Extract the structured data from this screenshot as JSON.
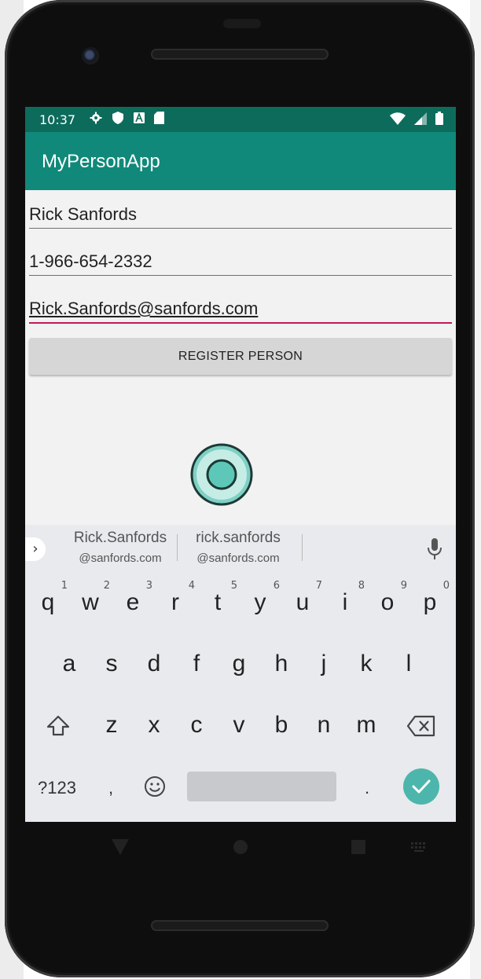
{
  "status_bar": {
    "time": "10:37",
    "left_icons": [
      "settings-icon",
      "shield-icon",
      "font-icon",
      "sd-card-icon"
    ],
    "right_icons": [
      "wifi-icon",
      "signal-icon",
      "battery-icon"
    ]
  },
  "app": {
    "title": "MyPersonApp",
    "colors": {
      "statusbar": "#0d6b5c",
      "appbar": "#10897a",
      "accent": "#c2185b"
    }
  },
  "form": {
    "name_value": "Rick Sanfords",
    "phone_value": "1-966-654-2332",
    "email_value": "Rick.Sanfords@sanfords.com",
    "register_label": "REGISTER PERSON"
  },
  "keyboard": {
    "suggestions": [
      {
        "user": "Rick.Sanfords",
        "domain": "@sanfords.com"
      },
      {
        "user": "rick.sanfords",
        "domain": "@sanfords.com"
      }
    ],
    "row1": [
      {
        "key": "q",
        "hint": "1"
      },
      {
        "key": "w",
        "hint": "2"
      },
      {
        "key": "e",
        "hint": "3"
      },
      {
        "key": "r",
        "hint": "4"
      },
      {
        "key": "t",
        "hint": "5"
      },
      {
        "key": "y",
        "hint": "6"
      },
      {
        "key": "u",
        "hint": "7"
      },
      {
        "key": "i",
        "hint": "8"
      },
      {
        "key": "o",
        "hint": "9"
      },
      {
        "key": "p",
        "hint": "0"
      }
    ],
    "row2": [
      "a",
      "s",
      "d",
      "f",
      "g",
      "h",
      "j",
      "k",
      "l"
    ],
    "row3": [
      "z",
      "x",
      "c",
      "v",
      "b",
      "n",
      "m"
    ],
    "symbols_label": "?123",
    "comma": ",",
    "period": ".",
    "icons": [
      "shift-icon",
      "backspace-icon",
      "emoji-icon",
      "mic-icon",
      "check-icon",
      "chevron-right-icon"
    ]
  },
  "nav": {
    "icons": [
      "back-icon",
      "home-icon",
      "recents-icon",
      "keyboard-switch-icon"
    ]
  }
}
